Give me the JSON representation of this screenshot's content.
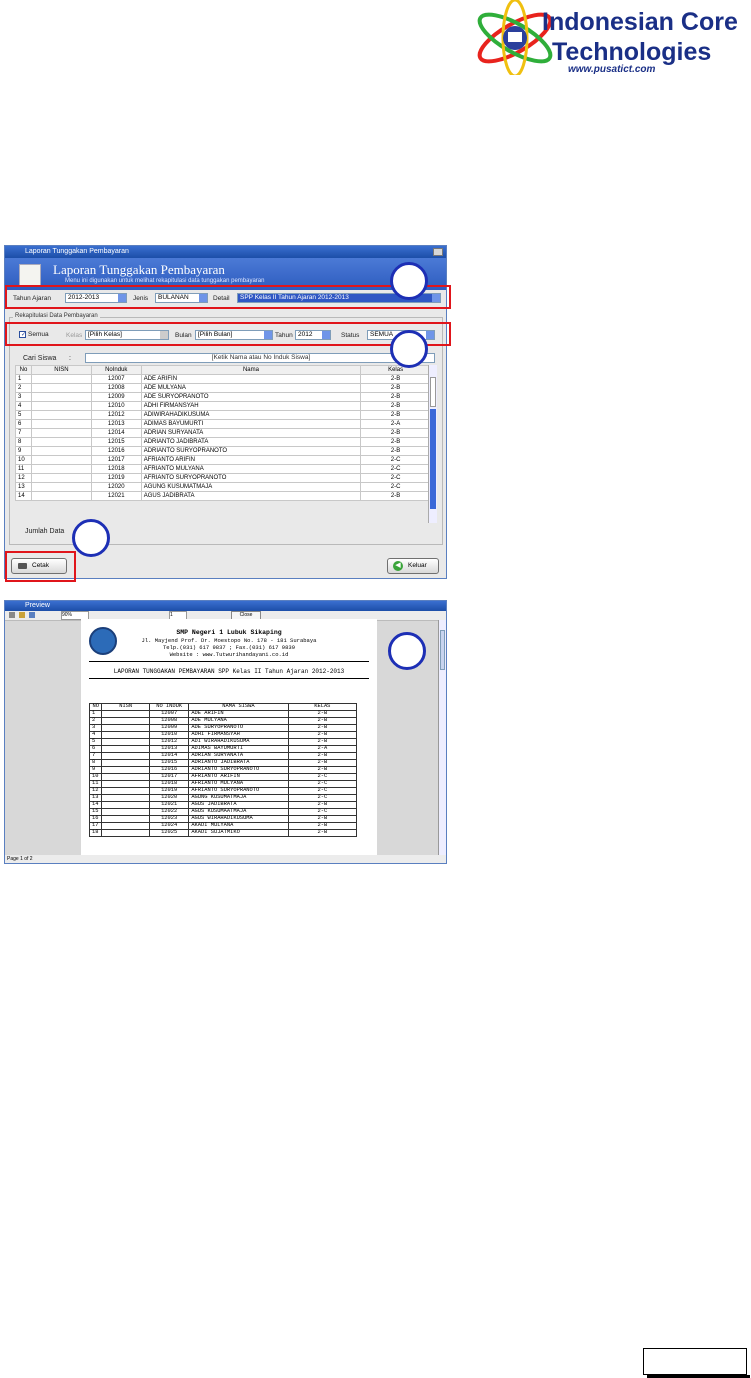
{
  "logo": {
    "line1": "Indonesian Core",
    "line2": "Technologies",
    "url": "www.pusatict.com"
  },
  "window1": {
    "title": "Laporan Tunggakan Pembayaran",
    "heading": "Laporan Tunggakan Pembayaran",
    "subtitle": "Menu ini digunakan untuk melihat rekapitulasi data tunggakan pembayaran",
    "filters": {
      "tahun_ajaran_label": "Tahun Ajaran",
      "tahun_ajaran_value": "2012-2013",
      "jenis_label": "Jenis",
      "jenis_value": "BULANAN",
      "detail_label": "Detail",
      "detail_value": "SPP Kelas II Tahun Ajaran 2012-2013"
    },
    "rekap": {
      "group_label": "Rekapitulasi Data Pembayaran",
      "semua_label": "Semua",
      "kelas_label": "Kelas",
      "kelas_value": "[Pilih Kelas]",
      "bulan_label": "Bulan",
      "bulan_value": "[Pilih Bulan]",
      "tahun_label": "Tahun",
      "tahun_value": "2012",
      "status_label": "Status",
      "status_value": "SEMUA"
    },
    "search": {
      "label": "Cari Siswa",
      "colon": ":",
      "placeholder": "[Ketik Nama atau No Induk Siswa]"
    },
    "table": {
      "headers": [
        "No",
        "NISN",
        "NoInduk",
        "Nama",
        "Kelas"
      ],
      "rows": [
        [
          "1",
          "",
          "12007",
          "ADE ARIFIN",
          "2-B"
        ],
        [
          "2",
          "",
          "12008",
          "ADE MULYANA",
          "2-B"
        ],
        [
          "3",
          "",
          "12009",
          "ADE SURYOPRANOTO",
          "2-B"
        ],
        [
          "4",
          "",
          "12010",
          "ADHI FIRMANSYAH",
          "2-B"
        ],
        [
          "5",
          "",
          "12012",
          "ADIWIRAHADIKUSUMA",
          "2-B"
        ],
        [
          "6",
          "",
          "12013",
          "ADIMAS BAYUMURTI",
          "2-A"
        ],
        [
          "7",
          "",
          "12014",
          "ADRIAN SURYANATA",
          "2-B"
        ],
        [
          "8",
          "",
          "12015",
          "ADRIANTO JADIBRATA",
          "2-B"
        ],
        [
          "9",
          "",
          "12016",
          "ADRIANTO SURYOPRANOTO",
          "2-B"
        ],
        [
          "10",
          "",
          "12017",
          "AFRIANTO ARIFIN",
          "2-C"
        ],
        [
          "11",
          "",
          "12018",
          "AFRIANTO MULYANA",
          "2-C"
        ],
        [
          "12",
          "",
          "12019",
          "AFRIANTO SURYOPRANOTO",
          "2-C"
        ],
        [
          "13",
          "",
          "12020",
          "AGUNG KUSUMATMAJA",
          "2-C"
        ],
        [
          "14",
          "",
          "12021",
          "AGUS JADIBRATA",
          "2-B"
        ]
      ]
    },
    "jumlah_label": "Jumlah Data",
    "cetak_label": "Cetak",
    "keluar_label": "Keluar"
  },
  "window2": {
    "title": "Preview",
    "zoom": "90%",
    "page_num": "1",
    "close_label": "Close",
    "status": "Page 1 of 2",
    "school": "SMP Negeri 1 Lubuk Sikaping",
    "address": "Jl. Mayjend Prof. Dr. Moestopo No. 178 - 181 Surabaya",
    "phone": "Telp.(031) 617 9837 ; Fax.(031) 617 9839",
    "website": "Website : www.Tutwurihandayani.co.id",
    "report_title": "LAPORAN TUNGGAKAN PEMBAYARAN SPP Kelas II Tahun Ajaran 2012-2013",
    "headers": [
      "NO",
      "NISN",
      "NO INDUK",
      "NAMA SISWA",
      "KELAS"
    ],
    "rows": [
      [
        "1",
        "",
        "12007",
        "ADE ARIFIN",
        "2-B"
      ],
      [
        "2",
        "",
        "12008",
        "ADE MULYANA",
        "2-B"
      ],
      [
        "3",
        "",
        "12009",
        "ADE SURYOPRANOTO",
        "2-B"
      ],
      [
        "4",
        "",
        "12010",
        "ADHI FIRMANSYAH",
        "2-B"
      ],
      [
        "5",
        "",
        "12012",
        "ADI WIRAHADIKUSUMA",
        "2-B"
      ],
      [
        "6",
        "",
        "12013",
        "ADIMAS BAYUMURTI",
        "2-A"
      ],
      [
        "7",
        "",
        "12014",
        "ADRIAN SURYANATA",
        "2-B"
      ],
      [
        "8",
        "",
        "12015",
        "ADRIANTO JADIBRATA",
        "2-B"
      ],
      [
        "9",
        "",
        "12016",
        "ADRIANTO SURYOPRANOTO",
        "2-B"
      ],
      [
        "10",
        "",
        "12017",
        "AFRIANTO ARIFIN",
        "2-C"
      ],
      [
        "11",
        "",
        "12018",
        "AFRIANTO MULYANA",
        "2-C"
      ],
      [
        "12",
        "",
        "12019",
        "AFRIANTO SURYOPRANOTO",
        "2-C"
      ],
      [
        "13",
        "",
        "12020",
        "AGUNG KUSUMATMAJA",
        "2-C"
      ],
      [
        "14",
        "",
        "12021",
        "AGUS JADIBRATA",
        "2-B"
      ],
      [
        "15",
        "",
        "12022",
        "AGUS KUSUMAATMAJA",
        "2-C"
      ],
      [
        "16",
        "",
        "12023",
        "AGUS WIRAHADIKUSUMA",
        "2-B"
      ],
      [
        "17",
        "",
        "12024",
        "AKADI MULYANA",
        "2-B"
      ],
      [
        "18",
        "",
        "12025",
        "AKADI SUJATMIKO",
        "2-B"
      ]
    ]
  }
}
